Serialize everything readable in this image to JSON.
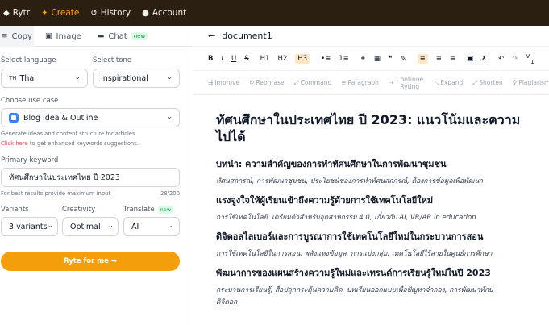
{
  "nav": {
    "items": [
      {
        "icon": "rytr-logo-icon",
        "glyph": "◆",
        "label": "Rytr",
        "active": false
      },
      {
        "icon": "sparkle-icon",
        "glyph": "✦",
        "label": "Create",
        "active": true
      },
      {
        "icon": "history-icon",
        "glyph": "↺",
        "label": "History",
        "active": false
      },
      {
        "icon": "account-icon",
        "glyph": "●",
        "label": "Account",
        "active": false
      }
    ]
  },
  "modes": [
    {
      "label": "Copy",
      "glyph": "≡"
    },
    {
      "label": "Image",
      "glyph": "▣"
    },
    {
      "label": "Chat",
      "glyph": "▬",
      "badge": "new"
    }
  ],
  "form": {
    "language_label": "Select language",
    "language_flag": "TH",
    "language_value": "Thai",
    "tone_label": "Select tone",
    "tone_value": "Inspirational",
    "usecase_label": "Choose use case",
    "usecase_value": "Blog Idea & Outline",
    "usecase_hint": "Generate ideas and content structure for articles",
    "usecase_hint_link": "Click here",
    "usecase_hint_rest": " to get enhanced keywords suggestions.",
    "keyword_label": "Primary keyword",
    "keyword_value": "ทัศนศึกษาในประเทศไทย ปี 2023",
    "keyword_hint": "For best results provide maximum input",
    "keyword_count": "28/200",
    "variants_label": "Variants",
    "variants_value": "3 variants",
    "creativity_label": "Creativity",
    "creativity_value": "Optimal",
    "translate_label": "Translate",
    "translate_badge": "new",
    "translate_value": "AI",
    "ryte_button": "Ryte for me →"
  },
  "editor": {
    "doc_title": "document1",
    "toolbar": [
      "B",
      "I",
      "U",
      "S",
      "H1",
      "H2",
      "H3",
      "•≡",
      "1≡",
      "⚭",
      "▦",
      "❝",
      "✎",
      "≡",
      "≡",
      "≡",
      "▣",
      "✗",
      "↶",
      "↷",
      "V",
      "1"
    ],
    "ai_actions": [
      {
        "label": "Improve",
        "glyph": "⇶"
      },
      {
        "label": "Rephrase",
        "glyph": "↻"
      },
      {
        "label": "Command",
        "glyph": "⤢"
      },
      {
        "label": "Paragraph",
        "glyph": "≡"
      },
      {
        "label": "Continue Ryting",
        "glyph": "⇢"
      },
      {
        "label": "Expand",
        "glyph": "⤡"
      },
      {
        "label": "Shorten",
        "glyph": "⤢"
      },
      {
        "label": "Plagiarism",
        "glyph": "⚲"
      }
    ],
    "title_line1": "ทัศนศึกษาในประเทศไทย ปี 2023: แนวโน้มและความ",
    "title_line2": "ไปได้",
    "sections": [
      {
        "heading": "บทนำ: ความสำคัญของการทำทัศนศึกษาในการพัฒนาชุมชน",
        "keywords": "ทัศนสถกรณ์, การพัฒนาชุมชน, ประโยชน์ของการทำทัศนสถกรณ์, ต้องการข้อมูลเพื่อพัฒนา"
      },
      {
        "heading": "แรงจูงใจให้ผู้เรียนเข้าถึงความรู้ด้วยการใช้เทคโนโลยีใหม่",
        "keywords": "การใช้เทคโนโลยี, เตรียมตัวสำหรับอุตสาหกรรม 4.0, เกี่ยวกับ AI, VR/AR in education"
      },
      {
        "heading": "ดิจิตอลไลเบอร์และการบูรณาการใช้เทคโนโลยีใหม่ในกระบวนการสอน",
        "keywords": "การใช้เทคโนโลยีในการสอน, พลังแห่งข้อมูล, การแบ่งกลุ่ม, เทคโนโลยีไร้สายในศูนย์การศึกษา"
      },
      {
        "heading": "พัฒนาการของแผนสร้างความรู้ใหม่และเทรนด์การเรียนรู้ใหม่ในปี 2023",
        "keywords": "กระบวนการเรียนรู้, สื่อปลุกกระตุ้นความคิด, บทเรียนออกแบบเพื่อปัญหาจำลอง, การพัฒนาทักษ"
      },
      {
        "heading": "",
        "keywords": "ดิจิตอล"
      }
    ]
  }
}
